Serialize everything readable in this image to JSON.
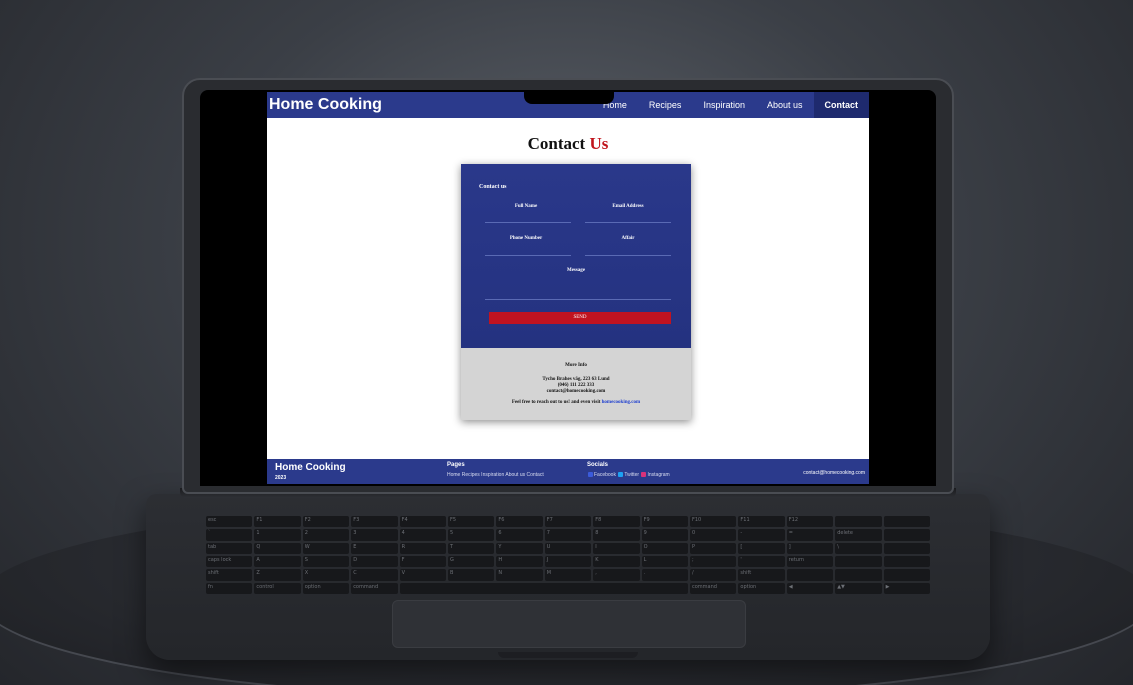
{
  "site": {
    "brand": "Home Cooking",
    "nav": [
      {
        "label": "Home",
        "active": false
      },
      {
        "label": "Recipes",
        "active": false
      },
      {
        "label": "Inspiration",
        "active": false
      },
      {
        "label": "About us",
        "active": false
      },
      {
        "label": "Contact",
        "active": true
      }
    ],
    "page_title_part1": "Contact",
    "page_title_part2": "Us",
    "form": {
      "heading": "Contact us",
      "full_name": "Full Name",
      "email": "Email Address",
      "phone": "Phone Number",
      "affair": "Affair",
      "message": "Message",
      "send": "SEND"
    },
    "info": {
      "heading": "More Info",
      "address": "Tycho Brahes väg, 223 63 Lund",
      "phone": "(046) 111 222 333",
      "email": "contact@homecooking.com",
      "cta_prefix": "Feel free to reach out to us! and even visit",
      "cta_link": "homecooking.com"
    },
    "footer": {
      "brand": "Home Cooking",
      "year": "2023",
      "pages_heading": "Pages",
      "pages_links": "Home Recipes Inspiration About us Contact",
      "socials_heading": "Socials",
      "social_facebook": "Facebook",
      "social_twitter": "Twitter",
      "social_instagram": "Instagram",
      "email": "contact@homecooking.com"
    },
    "colors": {
      "nav_blue": "#2b3a8c",
      "accent_red": "#c0141c",
      "link_blue": "#1f3fcf"
    }
  },
  "keyboard": {
    "keys": [
      "esc",
      "F1",
      "F2",
      "F3",
      "F4",
      "F5",
      "F6",
      "F7",
      "F8",
      "F9",
      "F10",
      "F11",
      "F12",
      "",
      "",
      "`",
      "1",
      "2",
      "3",
      "4",
      "5",
      "6",
      "7",
      "8",
      "9",
      "0",
      "-",
      "=",
      "delete",
      "",
      "tab",
      "Q",
      "W",
      "E",
      "R",
      "T",
      "Y",
      "U",
      "I",
      "O",
      "P",
      "[",
      "]",
      "\\",
      "",
      "caps lock",
      "A",
      "S",
      "D",
      "F",
      "G",
      "H",
      "J",
      "K",
      "L",
      ";",
      "'",
      "return",
      "",
      "",
      "shift",
      "Z",
      "X",
      "C",
      "V",
      "B",
      "N",
      "M",
      ",",
      ".",
      "/",
      "shift",
      "",
      "",
      ""
    ],
    "bottom": [
      "fn",
      "control",
      "option",
      "command",
      "",
      "command",
      "option",
      "◀",
      "▲▼",
      "▶"
    ]
  }
}
